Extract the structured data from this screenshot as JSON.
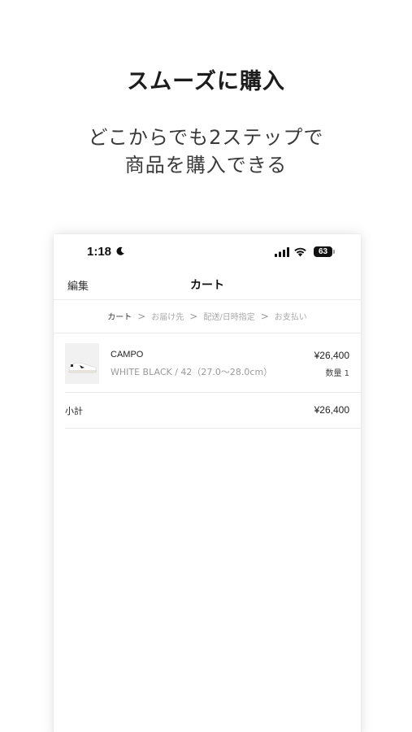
{
  "promo": {
    "headline": "スムーズに購入",
    "subline_1": "どこからでも2ステップで",
    "subline_2": "商品を購入できる"
  },
  "status_bar": {
    "time": "1:18",
    "battery": "63",
    "icons": [
      "moon-icon",
      "signal-icon",
      "wifi-icon",
      "battery-icon"
    ]
  },
  "nav": {
    "edit_label": "編集",
    "title": "カート"
  },
  "steps": {
    "items": [
      "カート",
      "お届け先",
      "配送/日時指定",
      "お支払い"
    ],
    "active_index": 0,
    "separator": ">"
  },
  "cart": {
    "items": [
      {
        "name": "CAMPO",
        "variant": "WHITE BLACK / 42（27.0〜28.0cm）",
        "price": "¥26,400",
        "quantity": "数量 1"
      }
    ],
    "subtotal_label": "小計",
    "subtotal_value": "¥26,400"
  },
  "colors": {
    "text_primary": "#222222",
    "text_muted": "#999999",
    "divider": "#ececec",
    "background": "#ffffff"
  }
}
